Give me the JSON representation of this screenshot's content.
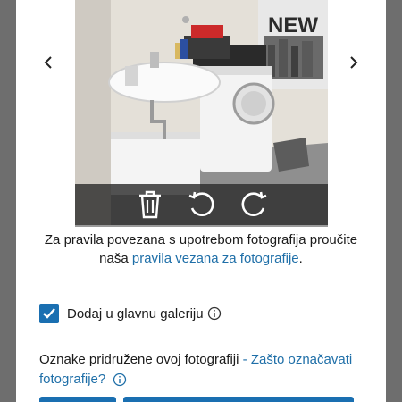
{
  "guidelines": {
    "text": "Za pravila povezana s upotrebom fotografija proučite naša",
    "link": "pravila vezana za fotografije",
    "suffix": "."
  },
  "gallery_checkbox": {
    "label": "Dodaj u glavnu galeriju",
    "checked": true
  },
  "tags": {
    "text": "Oznake pridružene ovoj fotografiji",
    "separator": " - ",
    "link": "Zašto označavati fotografije?"
  },
  "photo": {
    "poster_text": "NEW"
  },
  "colors": {
    "accent": "#1a6fb1",
    "link": "#1f6fa8",
    "toolbar": "#2d2d2d"
  },
  "icons": {
    "prev": "chevron-left-icon",
    "next": "chevron-right-icon",
    "delete": "trash-icon",
    "rotate_left": "rotate-left-icon",
    "rotate_right": "rotate-right-icon",
    "info": "info-icon",
    "check": "checkmark-icon"
  }
}
